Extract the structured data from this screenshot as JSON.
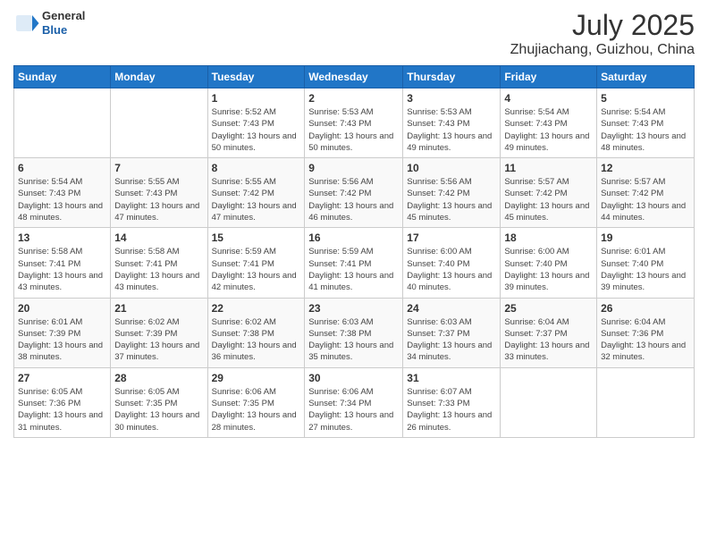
{
  "logo": {
    "general": "General",
    "blue": "Blue"
  },
  "title": "July 2025",
  "subtitle": "Zhujiachang, Guizhou, China",
  "weekdays": [
    "Sunday",
    "Monday",
    "Tuesday",
    "Wednesday",
    "Thursday",
    "Friday",
    "Saturday"
  ],
  "weeks": [
    [
      {
        "day": "",
        "info": ""
      },
      {
        "day": "",
        "info": ""
      },
      {
        "day": "1",
        "info": "Sunrise: 5:52 AM\nSunset: 7:43 PM\nDaylight: 13 hours and 50 minutes."
      },
      {
        "day": "2",
        "info": "Sunrise: 5:53 AM\nSunset: 7:43 PM\nDaylight: 13 hours and 50 minutes."
      },
      {
        "day": "3",
        "info": "Sunrise: 5:53 AM\nSunset: 7:43 PM\nDaylight: 13 hours and 49 minutes."
      },
      {
        "day": "4",
        "info": "Sunrise: 5:54 AM\nSunset: 7:43 PM\nDaylight: 13 hours and 49 minutes."
      },
      {
        "day": "5",
        "info": "Sunrise: 5:54 AM\nSunset: 7:43 PM\nDaylight: 13 hours and 48 minutes."
      }
    ],
    [
      {
        "day": "6",
        "info": "Sunrise: 5:54 AM\nSunset: 7:43 PM\nDaylight: 13 hours and 48 minutes."
      },
      {
        "day": "7",
        "info": "Sunrise: 5:55 AM\nSunset: 7:43 PM\nDaylight: 13 hours and 47 minutes."
      },
      {
        "day": "8",
        "info": "Sunrise: 5:55 AM\nSunset: 7:42 PM\nDaylight: 13 hours and 47 minutes."
      },
      {
        "day": "9",
        "info": "Sunrise: 5:56 AM\nSunset: 7:42 PM\nDaylight: 13 hours and 46 minutes."
      },
      {
        "day": "10",
        "info": "Sunrise: 5:56 AM\nSunset: 7:42 PM\nDaylight: 13 hours and 45 minutes."
      },
      {
        "day": "11",
        "info": "Sunrise: 5:57 AM\nSunset: 7:42 PM\nDaylight: 13 hours and 45 minutes."
      },
      {
        "day": "12",
        "info": "Sunrise: 5:57 AM\nSunset: 7:42 PM\nDaylight: 13 hours and 44 minutes."
      }
    ],
    [
      {
        "day": "13",
        "info": "Sunrise: 5:58 AM\nSunset: 7:41 PM\nDaylight: 13 hours and 43 minutes."
      },
      {
        "day": "14",
        "info": "Sunrise: 5:58 AM\nSunset: 7:41 PM\nDaylight: 13 hours and 43 minutes."
      },
      {
        "day": "15",
        "info": "Sunrise: 5:59 AM\nSunset: 7:41 PM\nDaylight: 13 hours and 42 minutes."
      },
      {
        "day": "16",
        "info": "Sunrise: 5:59 AM\nSunset: 7:41 PM\nDaylight: 13 hours and 41 minutes."
      },
      {
        "day": "17",
        "info": "Sunrise: 6:00 AM\nSunset: 7:40 PM\nDaylight: 13 hours and 40 minutes."
      },
      {
        "day": "18",
        "info": "Sunrise: 6:00 AM\nSunset: 7:40 PM\nDaylight: 13 hours and 39 minutes."
      },
      {
        "day": "19",
        "info": "Sunrise: 6:01 AM\nSunset: 7:40 PM\nDaylight: 13 hours and 39 minutes."
      }
    ],
    [
      {
        "day": "20",
        "info": "Sunrise: 6:01 AM\nSunset: 7:39 PM\nDaylight: 13 hours and 38 minutes."
      },
      {
        "day": "21",
        "info": "Sunrise: 6:02 AM\nSunset: 7:39 PM\nDaylight: 13 hours and 37 minutes."
      },
      {
        "day": "22",
        "info": "Sunrise: 6:02 AM\nSunset: 7:38 PM\nDaylight: 13 hours and 36 minutes."
      },
      {
        "day": "23",
        "info": "Sunrise: 6:03 AM\nSunset: 7:38 PM\nDaylight: 13 hours and 35 minutes."
      },
      {
        "day": "24",
        "info": "Sunrise: 6:03 AM\nSunset: 7:37 PM\nDaylight: 13 hours and 34 minutes."
      },
      {
        "day": "25",
        "info": "Sunrise: 6:04 AM\nSunset: 7:37 PM\nDaylight: 13 hours and 33 minutes."
      },
      {
        "day": "26",
        "info": "Sunrise: 6:04 AM\nSunset: 7:36 PM\nDaylight: 13 hours and 32 minutes."
      }
    ],
    [
      {
        "day": "27",
        "info": "Sunrise: 6:05 AM\nSunset: 7:36 PM\nDaylight: 13 hours and 31 minutes."
      },
      {
        "day": "28",
        "info": "Sunrise: 6:05 AM\nSunset: 7:35 PM\nDaylight: 13 hours and 30 minutes."
      },
      {
        "day": "29",
        "info": "Sunrise: 6:06 AM\nSunset: 7:35 PM\nDaylight: 13 hours and 28 minutes."
      },
      {
        "day": "30",
        "info": "Sunrise: 6:06 AM\nSunset: 7:34 PM\nDaylight: 13 hours and 27 minutes."
      },
      {
        "day": "31",
        "info": "Sunrise: 6:07 AM\nSunset: 7:33 PM\nDaylight: 13 hours and 26 minutes."
      },
      {
        "day": "",
        "info": ""
      },
      {
        "day": "",
        "info": ""
      }
    ]
  ]
}
